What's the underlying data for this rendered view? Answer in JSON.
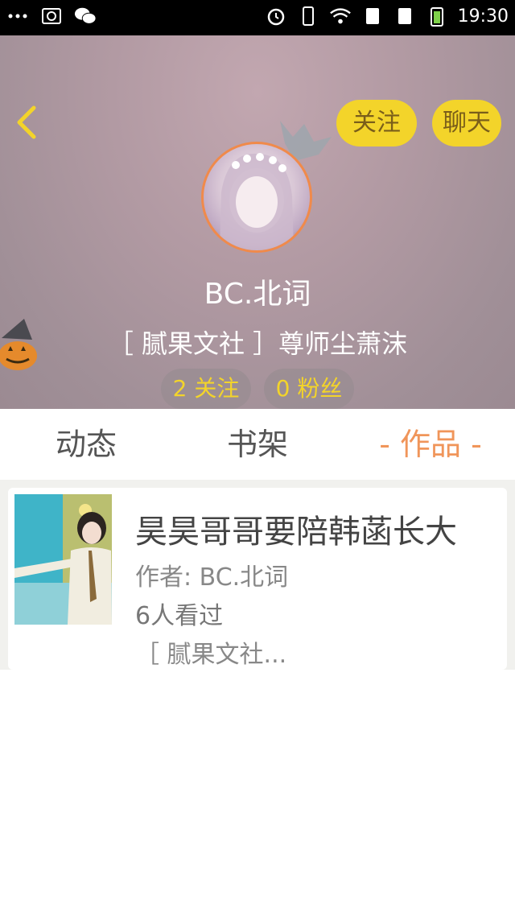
{
  "status_bar": {
    "time": "19:30",
    "left_icons": [
      "more-icon",
      "screenshot-icon",
      "wechat-icon"
    ],
    "right_icons": [
      "alarm-icon",
      "vibrate-icon",
      "wifi-icon",
      "sim1-icon",
      "sim2-icon",
      "battery-icon"
    ]
  },
  "header": {
    "follow_label": "关注",
    "chat_label": "聊天",
    "username": "BC.北词",
    "tagline": "［ 腻果文社 ］尊师尘萧沫",
    "following_count": "2 关注",
    "fans_count": "0 粉丝"
  },
  "tabs": [
    {
      "label": "动态"
    },
    {
      "label": "书架"
    },
    {
      "label": "- 作品 -",
      "active": true
    }
  ],
  "works": [
    {
      "title": "昊昊哥哥要陪韩菡长大",
      "author": "作者: BC.北词",
      "views": "6人看过",
      "tag": "［ 腻果文社..."
    }
  ],
  "colors": {
    "accent_yellow": "#f3d42a",
    "active_tab": "#f0955a",
    "avatar_border": "#f08a4b"
  }
}
